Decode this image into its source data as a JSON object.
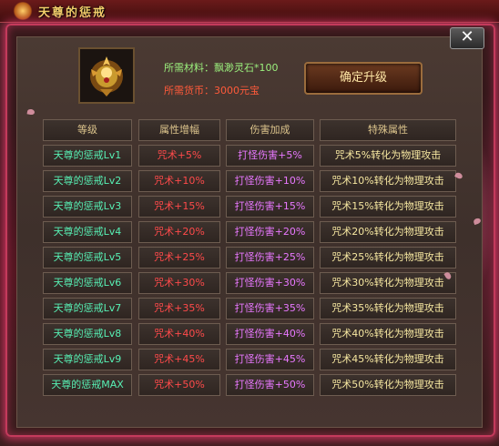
{
  "window": {
    "title": "天尊的惩戒",
    "close_label": "✕"
  },
  "upgrade": {
    "materials_label": "所需材料：飘渺灵石*100",
    "currency_label": "所需货币：3000元宝",
    "button_label": "确定升级"
  },
  "table": {
    "headers": [
      "等级",
      "属性增幅",
      "伤害加成",
      "特殊属性"
    ],
    "rows": [
      {
        "level": "天尊的惩戒Lv1",
        "attr": "咒术+5%",
        "dmg": "打怪伤害+5%",
        "spec": "咒术5%转化为物理攻击"
      },
      {
        "level": "天尊的惩戒Lv2",
        "attr": "咒术+10%",
        "dmg": "打怪伤害+10%",
        "spec": "咒术10%转化为物理攻击"
      },
      {
        "level": "天尊的惩戒Lv3",
        "attr": "咒术+15%",
        "dmg": "打怪伤害+15%",
        "spec": "咒术15%转化为物理攻击"
      },
      {
        "level": "天尊的惩戒Lv4",
        "attr": "咒术+20%",
        "dmg": "打怪伤害+20%",
        "spec": "咒术20%转化为物理攻击"
      },
      {
        "level": "天尊的惩戒Lv5",
        "attr": "咒术+25%",
        "dmg": "打怪伤害+25%",
        "spec": "咒术25%转化为物理攻击"
      },
      {
        "level": "天尊的惩戒Lv6",
        "attr": "咒术+30%",
        "dmg": "打怪伤害+30%",
        "spec": "咒术30%转化为物理攻击"
      },
      {
        "level": "天尊的惩戒Lv7",
        "attr": "咒术+35%",
        "dmg": "打怪伤害+35%",
        "spec": "咒术35%转化为物理攻击"
      },
      {
        "level": "天尊的惩戒Lv8",
        "attr": "咒术+40%",
        "dmg": "打怪伤害+40%",
        "spec": "咒术40%转化为物理攻击"
      },
      {
        "level": "天尊的惩戒Lv9",
        "attr": "咒术+45%",
        "dmg": "打怪伤害+45%",
        "spec": "咒术45%转化为物理攻击"
      },
      {
        "level": "天尊的惩戒MAX",
        "attr": "咒术+50%",
        "dmg": "打怪伤害+50%",
        "spec": "咒术50%转化为物理攻击"
      }
    ]
  },
  "colors": {
    "frame_glow": "#e63c6e",
    "level_text": "#57f0b4",
    "attr_text": "#ff4a4a",
    "dmg_text": "#e878ff",
    "spec_text": "#f6e7a0",
    "materials_text": "#9bf07d",
    "currency_text": "#ff5a3a"
  },
  "icons": {
    "item": "golden-ornament-icon",
    "close": "close-icon"
  }
}
